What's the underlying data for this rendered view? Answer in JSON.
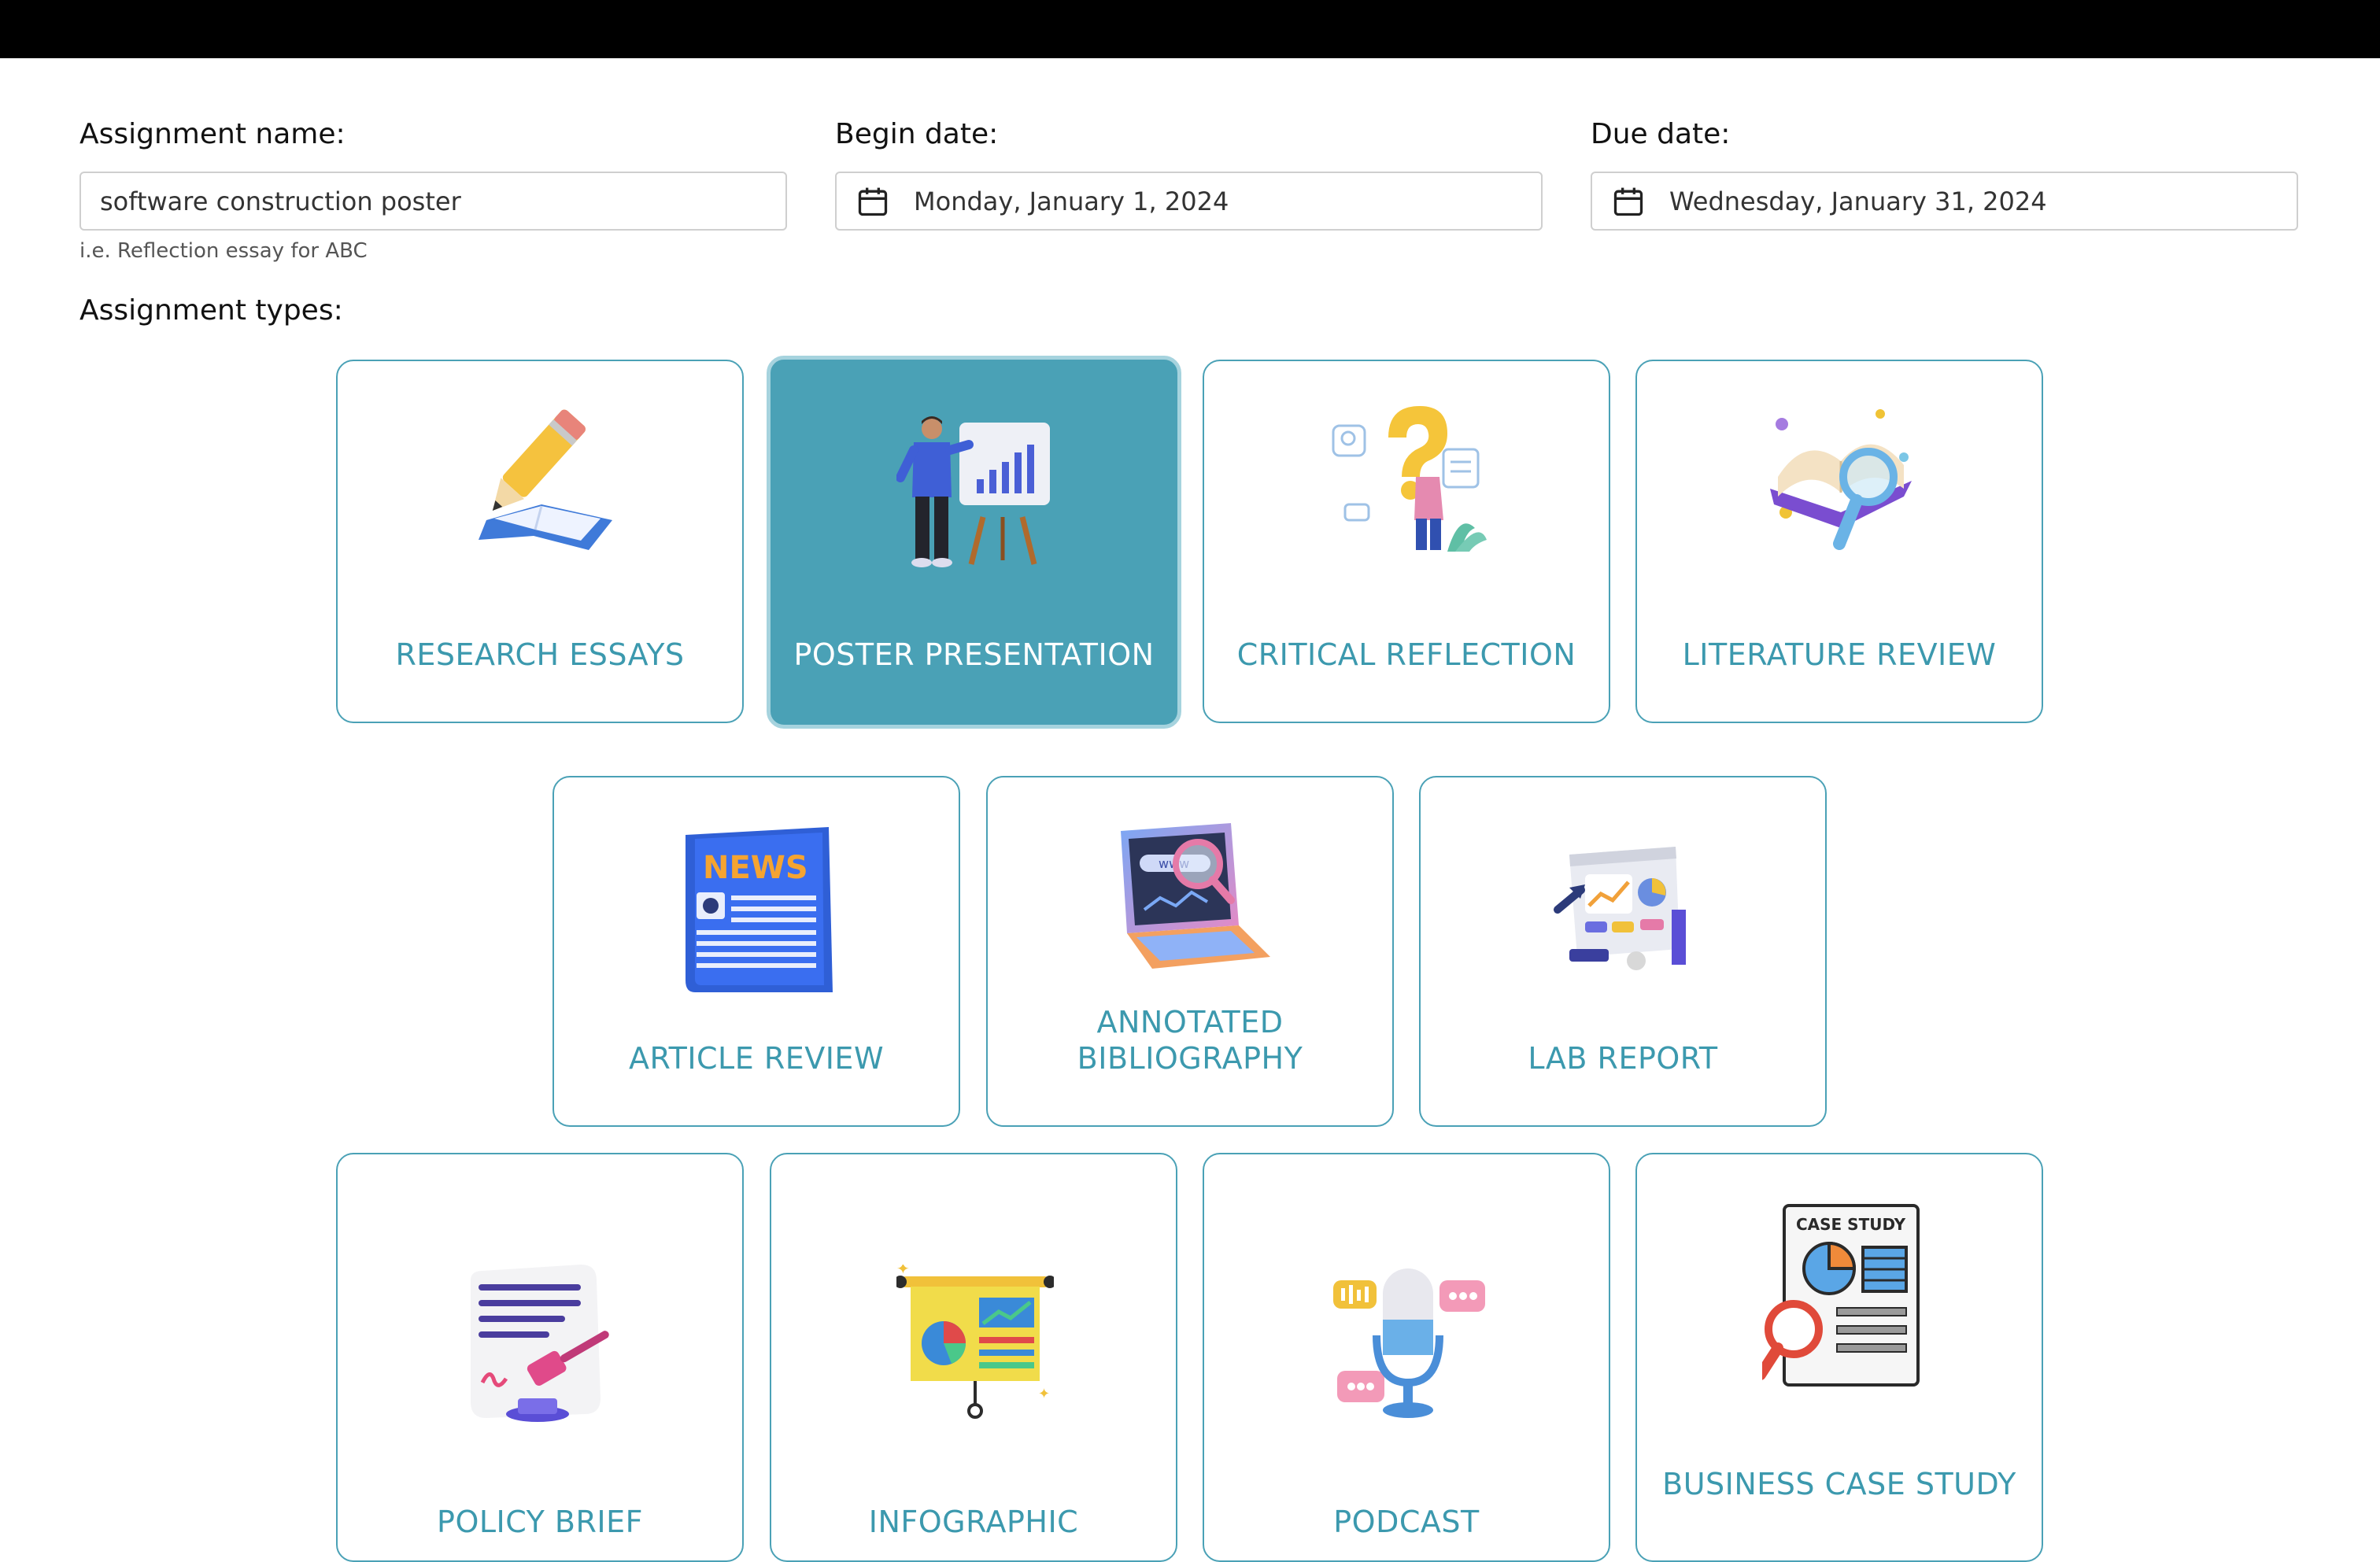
{
  "form": {
    "assignment_name_label": "Assignment name:",
    "assignment_name_value": "software construction poster",
    "assignment_name_hint": "i.e. Reflection essay for ABC",
    "begin_date_label": "Begin date:",
    "begin_date_value": "Monday, January 1, 2024",
    "due_date_label": "Due date:",
    "due_date_value": "Wednesday, January 31, 2024"
  },
  "assignment_types": {
    "label": "Assignment types:",
    "selected": "POSTER PRESENTATION",
    "items": [
      {
        "label": "RESEARCH ESSAYS",
        "icon": "pencil-book-icon"
      },
      {
        "label": "POSTER PRESENTATION",
        "icon": "presenter-chart-icon"
      },
      {
        "label": "CRITICAL REFLECTION",
        "icon": "question-mark-person-icon"
      },
      {
        "label": "LITERATURE REVIEW",
        "icon": "book-magnifier-icon"
      },
      {
        "label": "ARTICLE REVIEW",
        "icon": "newspaper-icon"
      },
      {
        "label": "ANNOTATED BIBLIOGRAPHY",
        "icon": "laptop-www-search-icon"
      },
      {
        "label": "LAB REPORT",
        "icon": "dashboard-report-icon"
      },
      {
        "label": "POLICY BRIEF",
        "icon": "document-gavel-icon"
      },
      {
        "label": "INFOGRAPHIC",
        "icon": "presentation-board-icon"
      },
      {
        "label": "PODCAST",
        "icon": "microphone-icon"
      },
      {
        "label": "BUSINESS CASE STUDY",
        "icon": "case-study-document-icon",
        "icon_text": "CASE STUDY"
      }
    ]
  },
  "colors": {
    "accent": "#4aa1b6",
    "accent_text": "#3c99ae",
    "selected_border": "#a6d3de",
    "top_bar": "#000000"
  }
}
